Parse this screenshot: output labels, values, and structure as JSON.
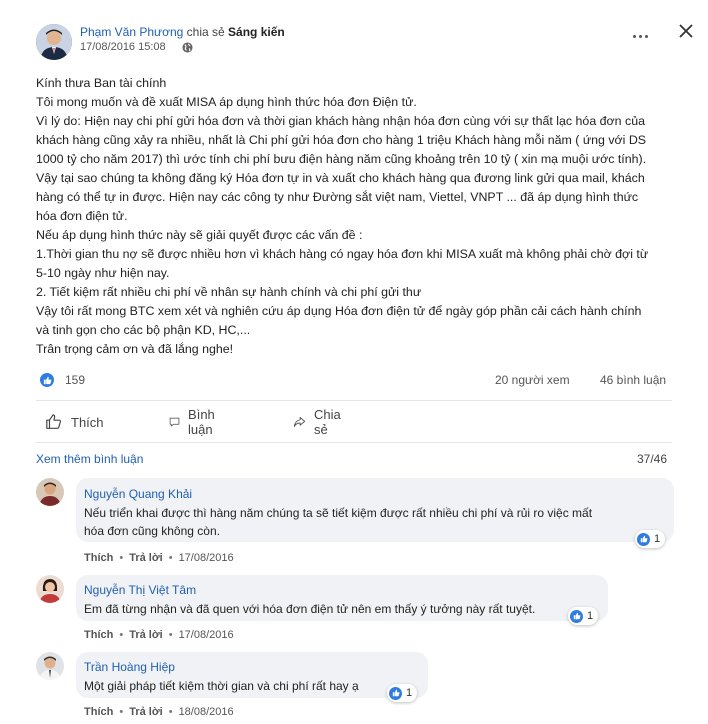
{
  "post": {
    "author": "Phạm Văn Phương",
    "shared_text": "chia sẻ",
    "target": "Sáng kiến",
    "timestamp": "17/08/2016 15:08",
    "body_lines": [
      "Kính thưa Ban tài chính",
      "Tôi mong muốn và đề xuất MISA áp dụng hình thức hóa đơn Điện tử.",
      "Vì lý do: Hiện nay chi phí gửi hóa đơn và thời gian khách hàng nhận hóa đơn cùng với sự thất lạc hóa đơn của",
      "khách hàng cũng xảy ra nhiều, nhất là Chi phí gửi hóa đơn cho hàng 1 triệu Khách hàng mỗi năm ( ứng với DS",
      "1000 tỷ cho năm 2017) thì ước tính chi phí bưu điện hàng năm cũng khoảng trên 10 tỷ ( xin mạ muội ước tính).",
      "Vậy tại sao chúng ta không đăng ký Hóa đơn tự in và xuất cho khách hàng qua đương link gửi qua mail, khách",
      "hàng có thể tự in được. Hiện nay các công ty như Đường sắt việt nam, Viettel, VNPT ... đã áp dụng hình thức",
      "hóa đơn điện tử.",
      "Nếu áp dụng hình thức này sẽ giải quyết được các vấn đề :",
      "1.Thời gian thu nợ sẽ được nhiều hơn vì khách hàng có ngay hóa đơn khi MISA xuất mà không phải chờ đợi từ",
      "5-10 ngày như hiện nay.",
      "2. Tiết kiệm rất nhiều chi phí về nhân sự hành chính và chi phí gửi thư",
      "Vậy tôi rất mong BTC xem xét và nghiên cứu áp dụng Hóa đơn điện tử để ngày góp phần cải cách hành chính",
      "và tinh gọn cho các bộ phận KD, HC,...",
      "Trân trọng cảm ơn và đã lắng nghe!"
    ],
    "likes": "159",
    "views": "20 người xem",
    "comments": "46 bình luận"
  },
  "actions": {
    "like": "Thích",
    "comment": "Bình luận",
    "share": "Chia sẻ"
  },
  "comments_section": {
    "more_label": "Xem thêm bình luận",
    "progress": "37/46",
    "items": [
      {
        "name": "Nguyễn Quang Khải",
        "text_lines": [
          "Nếu triển khai được thì hàng năm chúng ta sẽ tiết kiệm được rất nhiều chi phí và rủi ro việc mất",
          "hóa đơn cũng không còn."
        ],
        "reactions": "1",
        "like": "Thích",
        "reply": "Trả lời",
        "date": "17/08/2016"
      },
      {
        "name": "Nguyễn Thị Việt Tâm",
        "text_lines": [
          "Em đã từng nhận và đã quen với hóa đơn điện tử nên em thấy ý tưởng này rất tuyệt."
        ],
        "reactions": "1",
        "like": "Thích",
        "reply": "Trả lời",
        "date": "17/08/2016"
      },
      {
        "name": "Trần Hoàng Hiệp",
        "text_lines": [
          "Một giải pháp tiết kiệm thời gian và chi phí rất hay ạ"
        ],
        "reactions": "1",
        "like": "Thích",
        "reply": "Trả lời",
        "date": "18/08/2016"
      }
    ]
  },
  "colors": {
    "accent": "#1f5fb3",
    "like_blue": "#2f7de1",
    "bubble": "#f0f2f5"
  },
  "icons": [
    "more-icon",
    "close-icon",
    "globe-icon",
    "like-icon",
    "comment-icon",
    "share-icon"
  ]
}
